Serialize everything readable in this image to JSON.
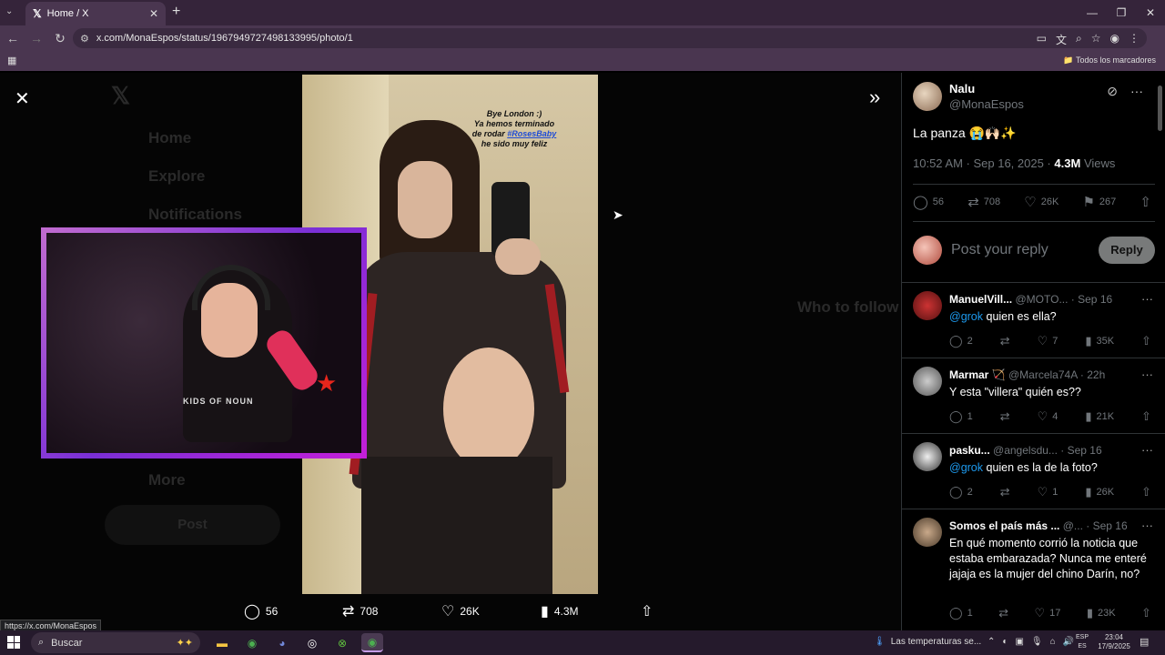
{
  "browser": {
    "tab_title": "Home / X",
    "tab_logo": "𝕏",
    "url": "x.com/MonaEspos/status/1967949727498133995/photo/1",
    "bookmarks_label": "Todos los marcadores",
    "status_url": "https://x.com/MonaEspos"
  },
  "viewer": {
    "ghost_nav": [
      "Home",
      "Explore",
      "Notifications",
      "More"
    ],
    "ghost_post": "Post",
    "ghost_right": [
      "Who to follow"
    ],
    "photo_caption_lines": [
      "Bye London :)",
      "Ya hemos terminado",
      "de rodar"
    ],
    "photo_caption_tag": "#RosesBaby",
    "photo_caption_end": "he sido muy feliz",
    "cam_shirt_text": "KIDS OF NOUN",
    "actions": {
      "replies": "56",
      "reposts": "708",
      "likes": "26K",
      "views": "4.3M"
    }
  },
  "post": {
    "author_name": "Nalu",
    "author_handle": "@MonaEspos",
    "text": "La panza 😭🙌🏻✨",
    "time": "10:52 AM · Sep 16, 2025 ·",
    "views_count": "4.3M",
    "views_label": "Views",
    "stats": {
      "replies": "56",
      "reposts": "708",
      "likes": "26K",
      "bookmarks": "267"
    },
    "reply_placeholder": "Post your reply",
    "reply_button": "Reply"
  },
  "replies": [
    {
      "name": "ManuelVill...",
      "handle": "@MOTO...",
      "time": "· Sep 16",
      "mention": "@grok",
      "text": " quien es ella?",
      "replies": "2",
      "likes": "7",
      "views": "35K"
    },
    {
      "name": "Marmar 🏹",
      "handle": "@Marcela74A",
      "time": "· 22h",
      "mention": "",
      "text": "Y esta \"villera\" quién es??",
      "replies": "1",
      "likes": "4",
      "views": "21K"
    },
    {
      "name": "pasku...",
      "handle": "@angelsdu...",
      "time": "· Sep 16",
      "mention": "@grok",
      "text": "  quien es la de la foto?",
      "replies": "2",
      "likes": "1",
      "views": "26K"
    },
    {
      "name": "Somos el país más ...",
      "handle": "@...",
      "time": "· Sep 16",
      "mention": "",
      "text": "En qué momento corrió la noticia que estaba embarazada? Nunca me enteré jajaja es la mujer del chino Darín, no?",
      "replies": "1",
      "likes": "17",
      "views": "23K"
    }
  ],
  "taskbar": {
    "search_label": "Buscar",
    "weather": "Las temperaturas se...",
    "lang_top": "ESP",
    "lang_bottom": "ES",
    "time": "23:04",
    "date": "17/9/2025"
  },
  "colors": {
    "browser_frame": "#35243a",
    "accent_link": "#1d9bf0",
    "cam_border": "#7a2fd6"
  }
}
